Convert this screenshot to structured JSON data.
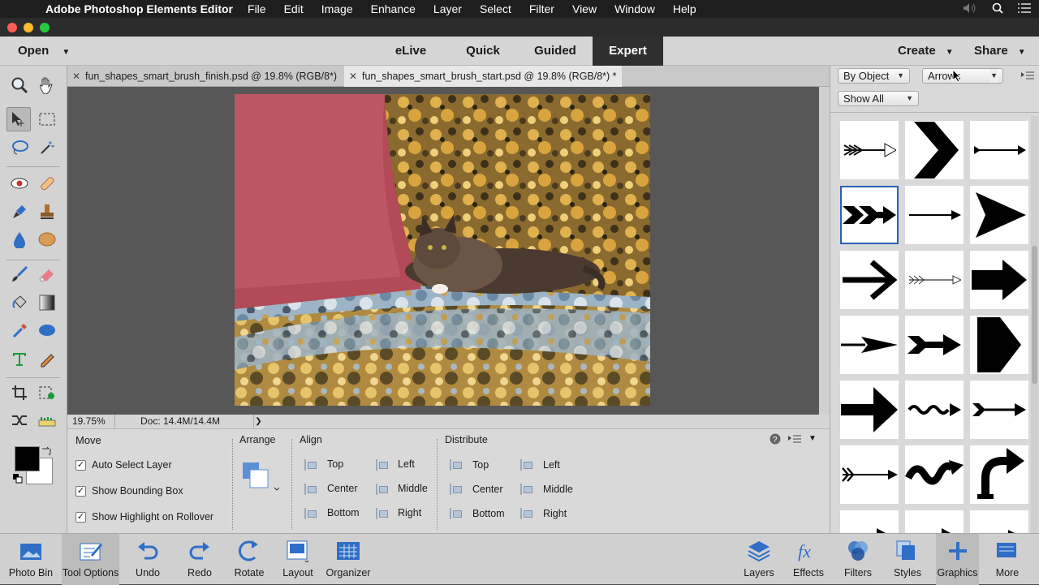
{
  "menubar": {
    "app_name": "Adobe Photoshop Elements Editor",
    "items": [
      "File",
      "Edit",
      "Image",
      "Enhance",
      "Layer",
      "Select",
      "Filter",
      "View",
      "Window",
      "Help"
    ]
  },
  "modebar": {
    "open_label": "Open",
    "modes": [
      "eLive",
      "Quick",
      "Guided",
      "Expert"
    ],
    "active_mode": "Expert",
    "create_label": "Create",
    "share_label": "Share"
  },
  "tabs": [
    {
      "title": "fun_shapes_smart_brush_finish.psd @ 19.8% (RGB/8*)",
      "active": false
    },
    {
      "title": "fun_shapes_smart_brush_start.psd @ 19.8% (RGB/8*) *",
      "active": true
    }
  ],
  "status": {
    "zoom": "19.75%",
    "doc": "Doc: 14.4M/14.4M"
  },
  "tool_options": {
    "tool_name": "Move",
    "checkboxes": [
      "Auto Select Layer",
      "Show Bounding Box",
      "Show Highlight on Rollover"
    ],
    "arrange_label": "Arrange",
    "align_label": "Align",
    "align_items": [
      "Top",
      "Center",
      "Bottom",
      "Left",
      "Middle",
      "Right"
    ],
    "distribute_label": "Distribute",
    "distribute_items": [
      "Top",
      "Center",
      "Bottom",
      "Left",
      "Middle",
      "Right"
    ]
  },
  "right_panel": {
    "by_object": "By Object",
    "category": "Arrows",
    "show_all": "Show All",
    "shapes": [
      "arrow-feathered",
      "chevron",
      "arrow-thin",
      "arrow-double-barb",
      "arrow-plain",
      "arrow-triangle",
      "arrow-open",
      "arrow-feathered-small",
      "arrow-block",
      "arrow-dart",
      "arrow-notched",
      "arrow-pentagon",
      "arrow-bold",
      "arrow-wavy",
      "arrow-fletched",
      "arrow-fletched-thin",
      "arrow-squiggle",
      "arrow-u-turn",
      "arrow-curved-1",
      "arrow-curved-2",
      "arrow-curved-3"
    ],
    "selected_index": 3
  },
  "taskbar": {
    "left": [
      "Photo Bin",
      "Tool Options",
      "Undo",
      "Redo",
      "Rotate",
      "Layout",
      "Organizer"
    ],
    "right": [
      "Layers",
      "Effects",
      "Filters",
      "Styles",
      "Graphics",
      "More"
    ],
    "selected": "Tool Options"
  },
  "colors": {
    "accent": "#2b5fb8",
    "icon_blue": "#2f6fc6",
    "active_mode_bg": "#2f2f2f"
  }
}
